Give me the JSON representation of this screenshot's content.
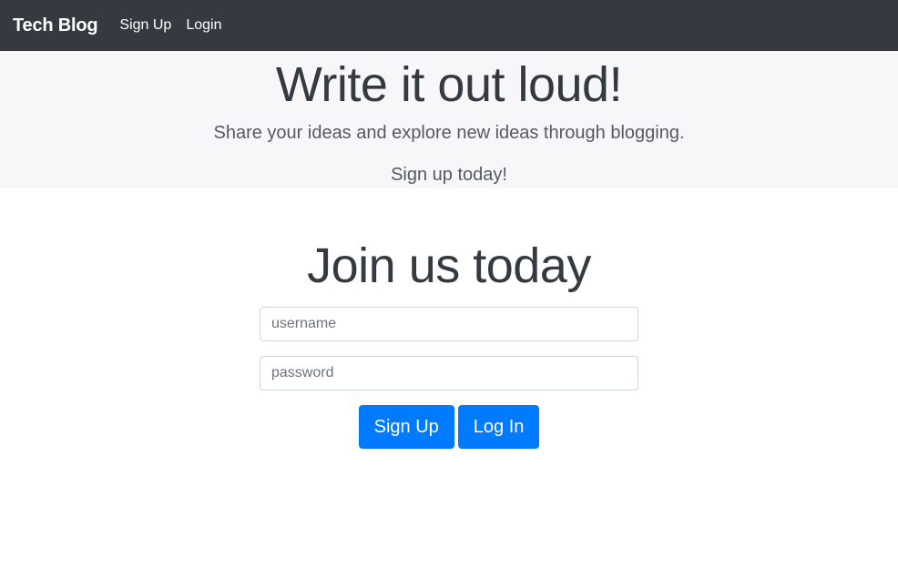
{
  "navbar": {
    "brand": "Tech Blog",
    "links": [
      "Sign Up",
      "Login"
    ]
  },
  "hero": {
    "title": "Write it out loud!",
    "subtitle": "Share your ideas and explore new ideas through blogging.",
    "cta": "Sign up today!"
  },
  "join": {
    "title": "Join us today",
    "username_placeholder": "username",
    "username_value": "",
    "password_placeholder": "password",
    "password_value": "",
    "signup_label": "Sign Up",
    "login_label": "Log In"
  },
  "colors": {
    "navbar_bg": "#343a40",
    "hero_bg": "#f7f7f9",
    "primary": "#007bff"
  }
}
